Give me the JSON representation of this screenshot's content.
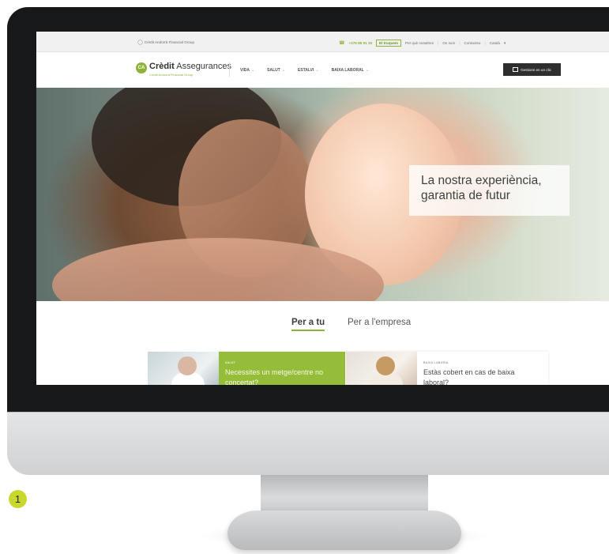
{
  "topbar": {
    "group_name": "Crèdit Andorrà Financial Group",
    "phone": "+376 88 91 19",
    "cta": "El truquem",
    "links": [
      "Per què nosaltres",
      "On som",
      "Contacteu",
      "Català"
    ]
  },
  "header": {
    "logo_mark": "CA",
    "brand_bold": "Crèdit",
    "brand_rest": "Assegurances",
    "brand_sub": "Crèdit Andorrà Financial Group",
    "nav": [
      "VIDA",
      "SALUT",
      "ESTALVI",
      "BAIXA LABORAL"
    ],
    "cta": "Gestions en un clic"
  },
  "hero": {
    "line1": "La nostra experiència,",
    "line2": "garantia de futur"
  },
  "tabs": [
    "Per a tu",
    "Per a l'empresa"
  ],
  "cards": [
    {
      "tag": "SALUT",
      "title": "Necessites un metge/centre no concertat?"
    },
    {
      "tag": "BAIXA LABORAL",
      "title": "Estàs cobert en cas de baixa laboral?"
    }
  ],
  "figure_number": "1",
  "colors": {
    "accent": "#8db33a",
    "card_green": "#95bd3a",
    "bezel": "#16181a",
    "badge": "#c8d82c"
  }
}
